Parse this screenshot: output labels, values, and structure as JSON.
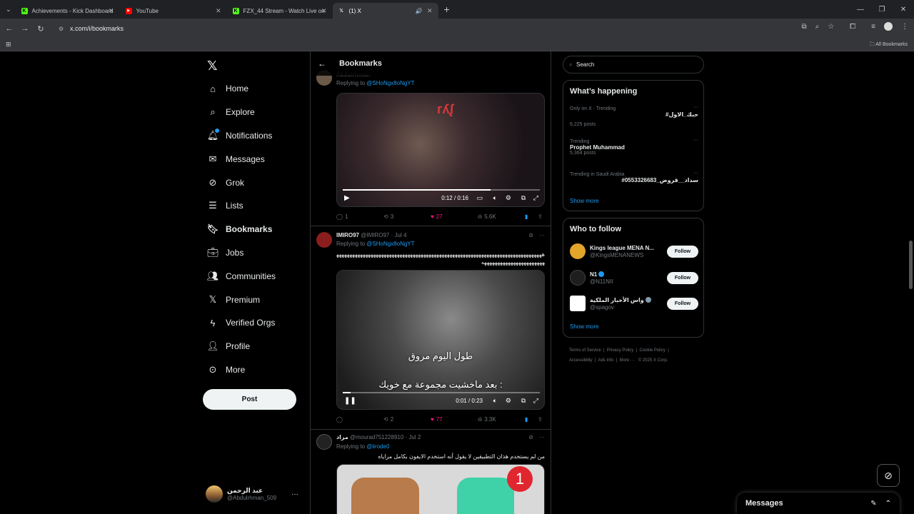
{
  "browser": {
    "tabs": [
      {
        "title": "Achievements - Kick Dashboard",
        "icon": "kick-icon",
        "color": "#53fc18"
      },
      {
        "title": "YouTube",
        "icon": "youtube-icon",
        "color": "#ff0000"
      },
      {
        "title": "FZX_44 Stream - Watch Live on",
        "icon": "kick-icon",
        "color": "#53fc18"
      },
      {
        "title": "(1) X",
        "icon": "x-icon",
        "color": "#ffffff"
      }
    ],
    "url": "x.com/i/bookmarks",
    "bookmarks_label": "All Bookmarks"
  },
  "nav": {
    "items": [
      {
        "label": "Home",
        "icon": "home-icon"
      },
      {
        "label": "Explore",
        "icon": "search-icon"
      },
      {
        "label": "Notifications",
        "icon": "bell-icon"
      },
      {
        "label": "Messages",
        "icon": "mail-icon"
      },
      {
        "label": "Grok",
        "icon": "grok-icon"
      },
      {
        "label": "Lists",
        "icon": "list-icon"
      },
      {
        "label": "Bookmarks",
        "icon": "bookmark-icon"
      },
      {
        "label": "Jobs",
        "icon": "briefcase-icon"
      },
      {
        "label": "Communities",
        "icon": "people-icon"
      },
      {
        "label": "Premium",
        "icon": "x-icon"
      },
      {
        "label": "Verified Orgs",
        "icon": "lightning-icon"
      },
      {
        "label": "Profile",
        "icon": "person-icon"
      },
      {
        "label": "More",
        "icon": "more-circle-icon"
      }
    ],
    "post_label": "Post",
    "account": {
      "name": "عبد الرحمن",
      "handle": "@Abdulrhman_509"
    }
  },
  "timeline": {
    "title": "Bookmarks",
    "tweets": [
      {
        "header_name": "Abdulrhman",
        "reply_prefix": "Replying to",
        "reply_to": "@SHoNgx8oNgYT",
        "video_time": "0:12 / 0:16",
        "progress": 0.75,
        "replies": "1",
        "reposts": "3",
        "likes": "27",
        "views": "5.6K"
      },
      {
        "name": "IMIRO97",
        "handle": "@IMIRO97",
        "date": "· Jul 4",
        "reply_prefix": "Replying to",
        "reply_to": "@SHoNgx8oNgYT",
        "text": "ههههههههههههههههههههههههههههههههههههههههههههههههههههههههههههههههههههههههههههههههههههههههههههههههههههههه",
        "caption1": "طول اليوم مروق",
        "caption2": "بعد ماخشيت مجموعة مع خويك :",
        "video_time": "0:01 / 0:23",
        "progress": 0.04,
        "replies": "",
        "reposts": "2",
        "likes": "77",
        "views": "3.3K"
      },
      {
        "name": "مراد",
        "handle": "@mourad751228910",
        "date": "· Jul 2",
        "reply_prefix": "Replying to",
        "reply_to": "@iirode0",
        "text": "من لم يستخدم هذان التطبيقين لا يقول أنه استخدم الايفون بكامل مزاياه",
        "badge": "1"
      }
    ]
  },
  "sidebar": {
    "search_placeholder": "Search",
    "happening_title": "What’s happening",
    "trends": [
      {
        "context": "Only on X · Trending",
        "name": "#حبك_الاول",
        "count": "6,225 posts"
      },
      {
        "context": "Trending",
        "name": "Prophet Muhammad",
        "count": "5,364 posts"
      },
      {
        "context": "Trending in Saudi Arabia",
        "name": "#سداد__قروض_0553326683",
        "count": ""
      }
    ],
    "show_more": "Show more",
    "who_title": "Who to follow",
    "follows": [
      {
        "name": "Kings league MENA N...",
        "handle": "@KingsMENANEWS",
        "button": "Follow"
      },
      {
        "name": "N1",
        "handle": "@N11NII",
        "button": "Follow"
      },
      {
        "name": "واس الأخبار الملكية",
        "handle": "@spagov",
        "button": "Follow"
      }
    ],
    "footer": [
      "Terms of Service",
      "Privacy Policy",
      "Cookie Policy",
      "Accessibility",
      "Ads info",
      "More ···",
      "© 2025 X Corp."
    ]
  },
  "messages_drawer": {
    "title": "Messages"
  }
}
